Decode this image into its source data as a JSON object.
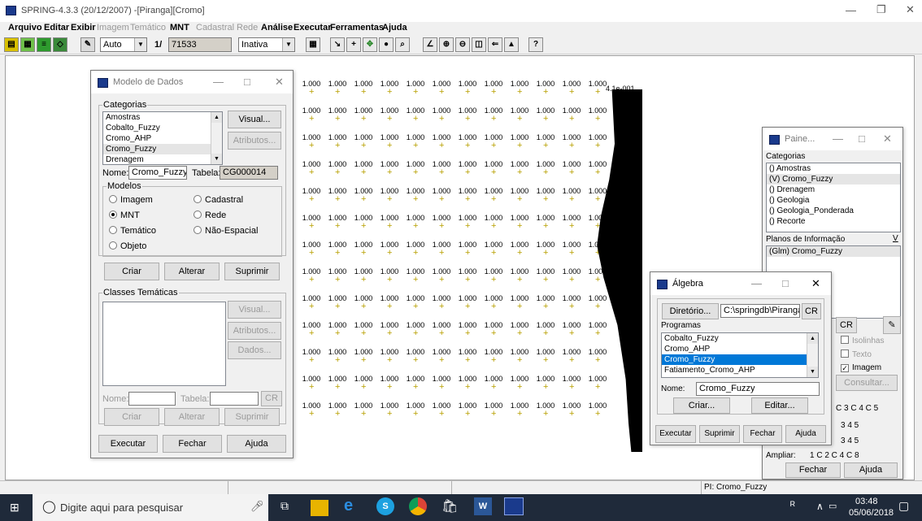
{
  "app": {
    "title": "SPRING-4.3.3 (20/12/2007) -[Piranga][Cromo]"
  },
  "menu": [
    "Arquivo",
    "Editar",
    "Exibir",
    "Imagem",
    "Temático",
    "MNT",
    "Cadastral",
    "Rede",
    "Análise",
    "Executar",
    "Ferramentas",
    "Ajuda"
  ],
  "toolbar": {
    "scale_mode": "Auto",
    "scale_prefix": "1/",
    "scale_value": "71533",
    "state": "Inativa"
  },
  "map": {
    "cell_value": "1.000",
    "edge_value": "4.1e-001",
    "edge_short": "4.1e"
  },
  "modelo": {
    "title": "Modelo de Dados",
    "categorias_label": "Categorias",
    "categorias": [
      "Amostras",
      "Cobalto_Fuzzy",
      "Cromo_AHP",
      "Cromo_Fuzzy",
      "Drenagem"
    ],
    "visual": "Visual...",
    "atributos": "Atributos...",
    "nome_label": "Nome:",
    "nome_value": "Cromo_Fuzzy",
    "tabela_label": "Tabela:",
    "tabela_value": "CG000014",
    "modelos_label": "Modelos",
    "m_imagem": "Imagem",
    "m_cadastral": "Cadastral",
    "m_mnt": "MNT",
    "m_rede": "Rede",
    "m_tematico": "Temático",
    "m_naoespacial": "Não-Espacial",
    "m_objeto": "Objeto",
    "criar": "Criar",
    "alterar": "Alterar",
    "suprimir": "Suprimir",
    "classes_label": "Classes Temáticas",
    "c_visual": "Visual...",
    "c_atributos": "Atributos...",
    "c_dados": "Dados...",
    "c_nome_label": "Nome:",
    "c_tabela_label": "Tabela:",
    "cr": "CR",
    "executar": "Executar",
    "fechar": "Fechar",
    "ajuda": "Ajuda"
  },
  "painel": {
    "title": "Paine...",
    "categorias_label": "Categorias",
    "categorias": [
      "() Amostras",
      "(V) Cromo_Fuzzy",
      "() Drenagem",
      "() Geologia",
      "() Geologia_Ponderada",
      "() Recorte"
    ],
    "planos_label": "Planos de Informação",
    "planos_v": "V",
    "planos": [
      "(Glm) Cromo_Fuzzy"
    ],
    "cr": "CR",
    "isolinhas": "Isolinhas",
    "texto": "Texto",
    "imagem": "Imagem",
    "consultar": "Consultar...",
    "r1": "C 3  C 4  C 5",
    "r2": "3  4  5",
    "r3": "3  4  5",
    "ampliar": "Ampliar:",
    "amp_opts": "1   C 2   C 4   C 8",
    "fechar": "Fechar",
    "ajuda": "Ajuda"
  },
  "algebra": {
    "title": "Álgebra",
    "diretorio_btn": "Diretório...",
    "diretorio_path": "C:\\springdb\\Piranga\\Pr",
    "cr": "CR",
    "programas_label": "Programas",
    "programas": [
      "Cobalto_Fuzzy",
      "Cromo_AHP",
      "Cromo_Fuzzy",
      "Fatiamento_Cromo_AHP"
    ],
    "nome_label": "Nome:",
    "nome_value": "Cromo_Fuzzy",
    "criar": "Criar...",
    "editar": "Editar...",
    "executar": "Executar",
    "suprimir": "Suprimir",
    "fechar": "Fechar",
    "ajuda": "Ajuda"
  },
  "status": {
    "pi": "PI: Cromo_Fuzzy"
  },
  "taskbar": {
    "search_placeholder": "Digite aqui para pesquisar",
    "time": "03:48",
    "date": "05/06/2018"
  }
}
